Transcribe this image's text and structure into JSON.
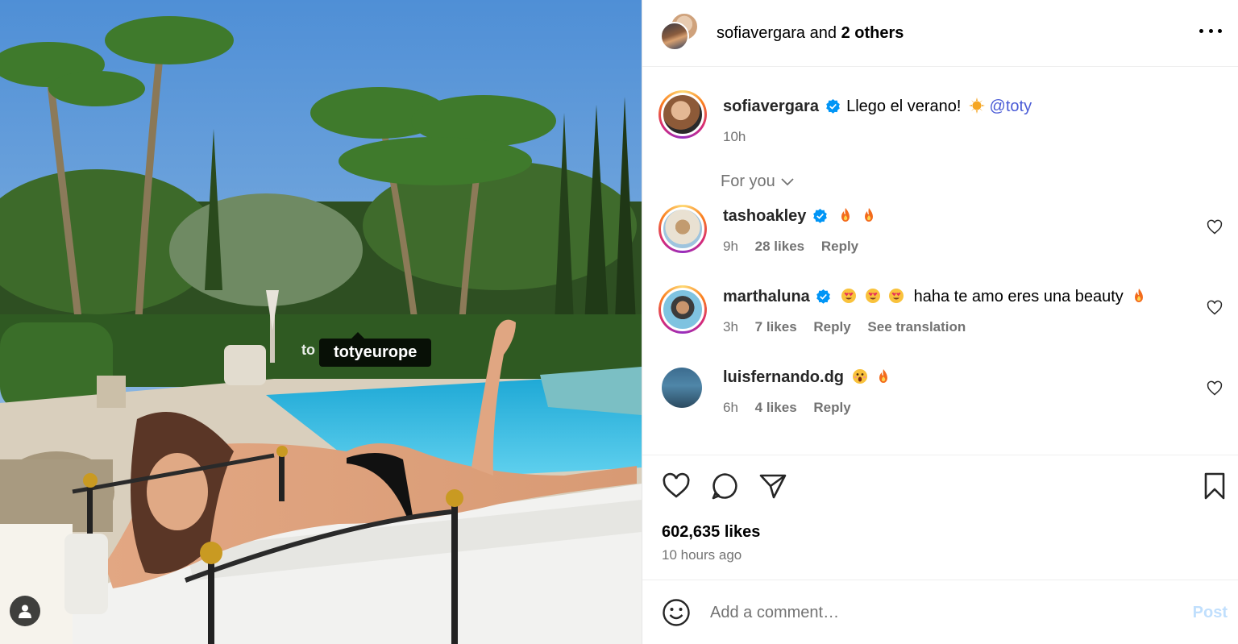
{
  "header": {
    "author": "sofiavergara",
    "joiner": "and",
    "others": "2 others"
  },
  "caption": {
    "username": "sofiavergara",
    "text": "Llego el verano!",
    "emoji": "sun",
    "mention": "@toty",
    "time": "10h"
  },
  "filter": {
    "label": "For you"
  },
  "comments": [
    {
      "username": "tashoakley",
      "verified": true,
      "text": "",
      "emojis": [
        "fire",
        "fire"
      ],
      "time": "9h",
      "likes": "28 likes",
      "reply": "Reply"
    },
    {
      "username": "marthaluna",
      "verified": true,
      "text": "haha te amo eres una beauty",
      "emojis": [
        "heart-eyes",
        "heart-eyes",
        "heart-eyes"
      ],
      "trailing_emoji": "fire",
      "time": "3h",
      "likes": "7 likes",
      "reply": "Reply",
      "translate": "See translation"
    },
    {
      "username": "luisfernando.dg",
      "verified": false,
      "text": "",
      "emojis": [
        "shocked",
        "fire"
      ],
      "time": "6h",
      "likes": "4 likes",
      "reply": "Reply"
    }
  ],
  "post": {
    "likes": "602,635 likes",
    "time_ago": "10 hours ago"
  },
  "composer": {
    "placeholder": "Add a comment…",
    "post_label": "Post"
  },
  "media": {
    "tag_label": "totyeurope",
    "tag_ghost": "to",
    "product_brand": "toty"
  },
  "colors": {
    "mention": "#4a5bd6",
    "verified": "#0095f6",
    "post_disabled": "#c0dffd",
    "meta_gray": "#737373"
  }
}
